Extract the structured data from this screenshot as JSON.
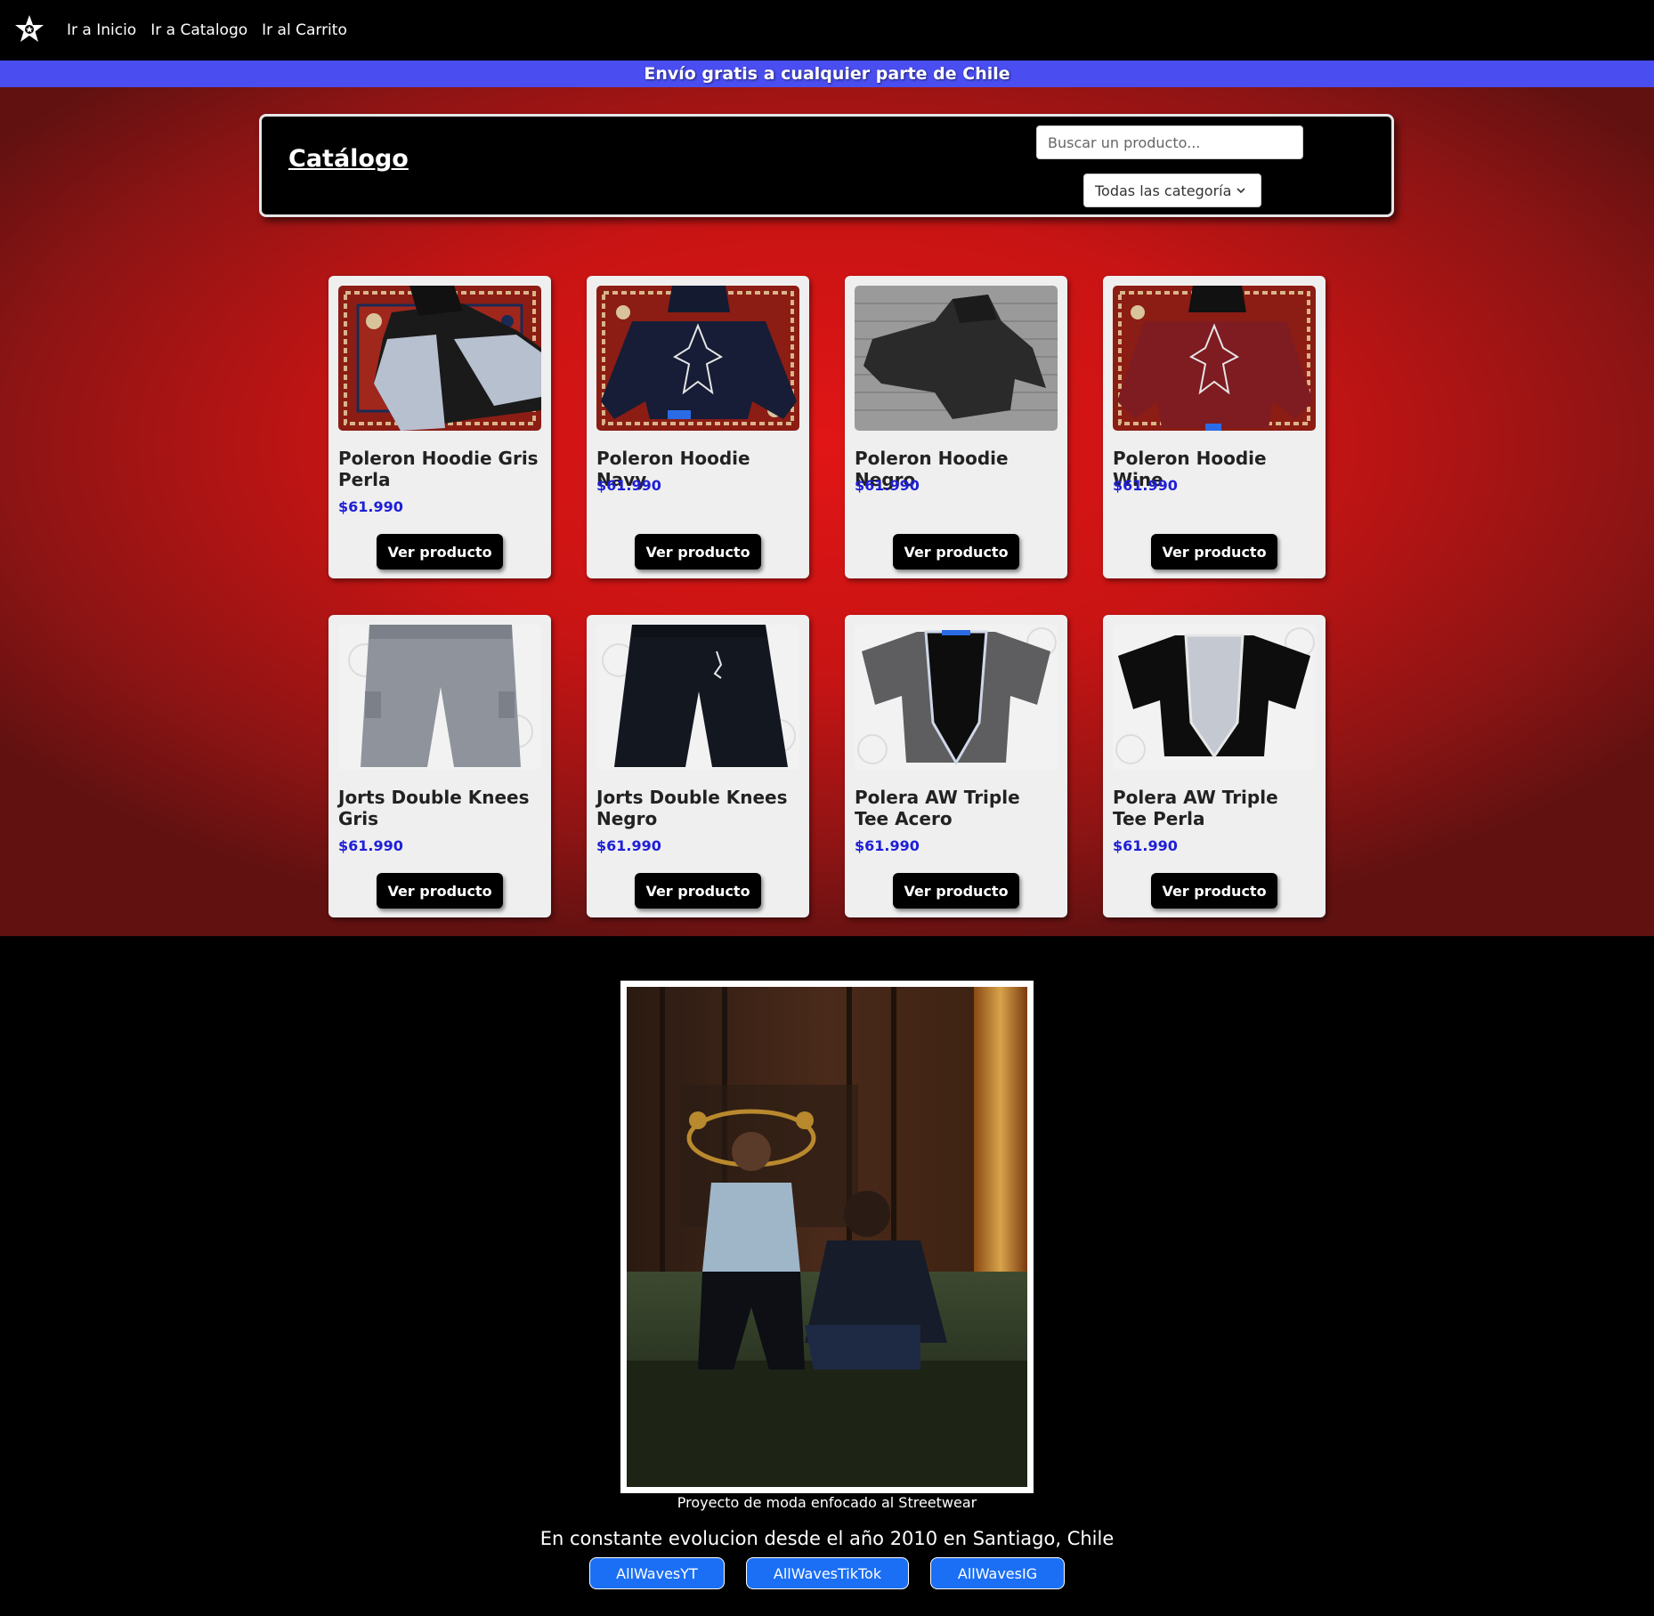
{
  "nav": {
    "logo_icon": "star-badge-icon",
    "links": [
      "Ir a Inicio",
      "Ir a Catalogo",
      "Ir al Carrito"
    ]
  },
  "promo": {
    "text": "Envío gratis a cualquier parte de Chile"
  },
  "catalog": {
    "title": "Catálogo",
    "search_placeholder": "Buscar un producto...",
    "category_selected": "Todas las categorías"
  },
  "products": [
    {
      "name": "Poleron Hoodie Gris Perla",
      "price": "$61.990",
      "button": "Ver producto"
    },
    {
      "name": "Poleron Hoodie Navy",
      "price": "$61.990",
      "button": "Ver producto"
    },
    {
      "name": "Poleron Hoodie Negro",
      "price": "$61.990",
      "button": "Ver producto"
    },
    {
      "name": "Poleron Hoodie Wine",
      "price": "$61.990",
      "button": "Ver producto"
    },
    {
      "name": "Jorts Double Knees Gris",
      "price": "$61.990",
      "button": "Ver producto"
    },
    {
      "name": "Jorts Double Knees Negro",
      "price": "$61.990",
      "button": "Ver producto"
    },
    {
      "name": "Polera AW Triple Tee Acero",
      "price": "$61.990",
      "button": "Ver producto"
    },
    {
      "name": "Polera AW Triple Tee Perla",
      "price": "$61.990",
      "button": "Ver producto"
    }
  ],
  "footer": {
    "caption": "Proyecto de moda enfocado al Streetwear",
    "slogan": "En constante evolucion desde el año 2010 en Santiago, Chile",
    "social": [
      "AllWavesYT",
      "AllWavesTikTok",
      "AllWavesIG"
    ]
  },
  "colors": {
    "promo_bar": "#4a4df0",
    "price": "#1e1ed8",
    "social_button": "#1b6ff5",
    "section_red": "#e11515"
  }
}
